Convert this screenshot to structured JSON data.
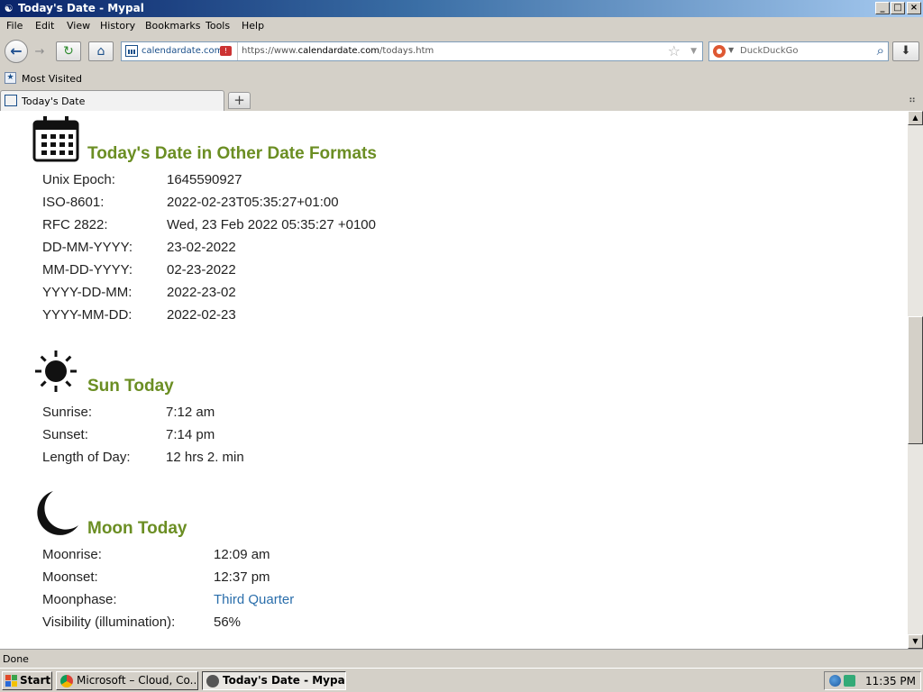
{
  "window": {
    "title": "Today's Date - Mypal",
    "controls": {
      "minimize": "_",
      "maximize": "□",
      "close": "×"
    }
  },
  "menu": [
    "File",
    "Edit",
    "View",
    "History",
    "Bookmarks",
    "Tools",
    "Help"
  ],
  "navbar": {
    "site_label": "calendardate.com",
    "url_prefix": "https://www.",
    "url_host": "calendardate.com",
    "url_path": "/todays.htm",
    "search_placeholder": "DuckDuckGo"
  },
  "bookmarks": {
    "most_visited": "Most Visited"
  },
  "tabs": [
    {
      "label": "Today's Date"
    }
  ],
  "page": {
    "formats": {
      "heading": "Today's Date in Other Date Formats",
      "rows": [
        {
          "label": "Unix Epoch:",
          "value": "1645590927"
        },
        {
          "label": "ISO-8601:",
          "value": "2022-02-23T05:35:27+01:00"
        },
        {
          "label": "RFC 2822:",
          "value": "Wed, 23 Feb 2022 05:35:27 +0100"
        },
        {
          "label": "DD-MM-YYYY:",
          "value": "23-02-2022"
        },
        {
          "label": "MM-DD-YYYY:",
          "value": "02-23-2022"
        },
        {
          "label": "YYYY-DD-MM:",
          "value": "2022-23-02"
        },
        {
          "label": "YYYY-MM-DD:",
          "value": "2022-02-23"
        }
      ]
    },
    "sun": {
      "heading": "Sun Today",
      "rows": [
        {
          "label": "Sunrise:",
          "value": "7:12 am"
        },
        {
          "label": "Sunset:",
          "value": "7:14 pm"
        },
        {
          "label": "Length of Day:",
          "value": "12 hrs 2. min"
        }
      ]
    },
    "moon": {
      "heading": "Moon Today",
      "rows": [
        {
          "label": "Moonrise:",
          "value": "12:09 am"
        },
        {
          "label": "Moonset:",
          "value": "12:37 pm"
        },
        {
          "label": "Moonphase:",
          "value": "Third Quarter"
        },
        {
          "label": "Visibility (illumination):",
          "value": "56%"
        }
      ]
    }
  },
  "status": "Done",
  "taskbar": {
    "start": "Start",
    "items": [
      {
        "label": "Microsoft – Cloud, Co..."
      },
      {
        "label": "Today's Date - Mypal"
      }
    ],
    "clock": "11:35 PM"
  },
  "colors": {
    "heading_green": "#6b8e23",
    "link_blue": "#2a6eab",
    "titlebar": "#0a246a"
  }
}
